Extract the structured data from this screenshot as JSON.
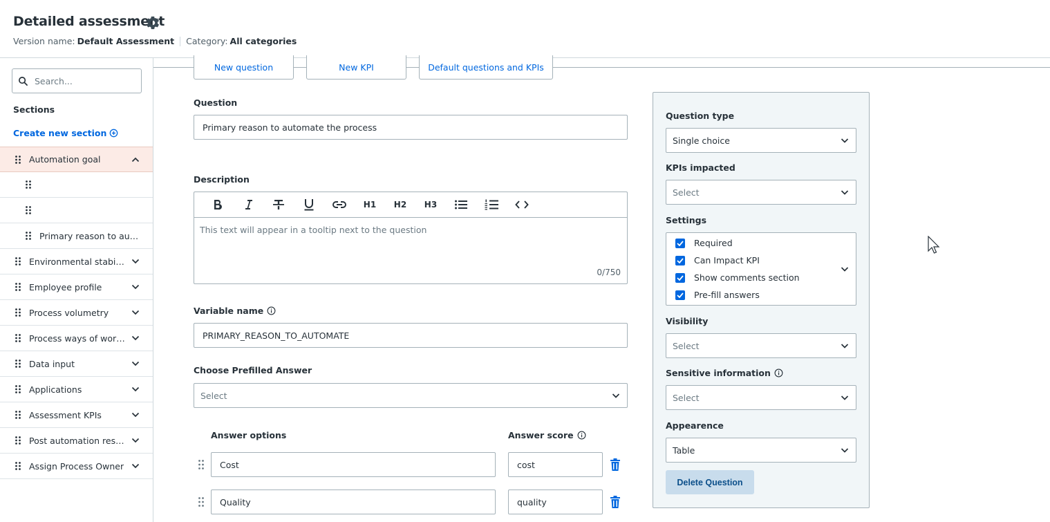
{
  "header": {
    "title": "Detailed assessment",
    "version_label": "Version name:",
    "version_value": "Default Assessment",
    "category_label": "Category:",
    "category_value": "All categories"
  },
  "sidebar": {
    "search_placeholder": "Search...",
    "sections_label": "Sections",
    "create_label": "Create new section",
    "items": [
      {
        "label": "Automation goal",
        "expanded": true
      },
      {
        "label": "",
        "child": true
      },
      {
        "label": "",
        "child": true
      },
      {
        "label": "Primary reason to auto...",
        "child": true
      },
      {
        "label": "Environmental stability"
      },
      {
        "label": "Employee profile"
      },
      {
        "label": "Process volumetry"
      },
      {
        "label": "Process ways of worki..."
      },
      {
        "label": "Data input"
      },
      {
        "label": "Applications"
      },
      {
        "label": "Assessment KPIs"
      },
      {
        "label": "Post automation results"
      },
      {
        "label": "Assign Process Owner"
      }
    ]
  },
  "tabs": [
    "New question",
    "New KPI",
    "Default questions and KPIs"
  ],
  "form": {
    "question_label": "Question",
    "question_value": "Primary reason to automate the process",
    "description_label": "Description",
    "toolbar": [
      "B",
      "I",
      "S",
      "U",
      "link",
      "H1",
      "H2",
      "H3",
      "bullets",
      "numbers",
      "code"
    ],
    "description_placeholder": "This text will appear in a tooltip next to the question",
    "char_count": "0/750",
    "variable_label": "Variable name",
    "variable_value": "PRIMARY_REASON_TO_AUTOMATE",
    "prefill_label": "Choose Prefilled Answer",
    "prefill_value": "Select",
    "answer_options_label": "Answer options",
    "answer_score_label": "Answer score",
    "answers": [
      {
        "option": "Cost",
        "score": "cost"
      },
      {
        "option": "Quality",
        "score": "quality"
      }
    ]
  },
  "panel": {
    "question_type_label": "Question type",
    "question_type_value": "Single choice",
    "kpis_label": "KPIs impacted",
    "kpis_value": "Select",
    "settings_label": "Settings",
    "settings": [
      {
        "label": "Required",
        "checked": true
      },
      {
        "label": "Can Impact KPI",
        "checked": true
      },
      {
        "label": "Show comments section",
        "checked": true
      },
      {
        "label": "Pre-fill answers",
        "checked": true
      }
    ],
    "visibility_label": "Visibility",
    "visibility_value": "Select",
    "sensitive_label": "Sensitive information",
    "sensitive_value": "Select",
    "appearance_label": "Appearence",
    "appearance_value": "Table",
    "delete_label": "Delete Question"
  },
  "colors": {
    "accent": "#0067df",
    "active_row_bg": "#fcebe6",
    "panel_bg": "#f1f6f8",
    "delete_bg": "#c8dcec"
  }
}
